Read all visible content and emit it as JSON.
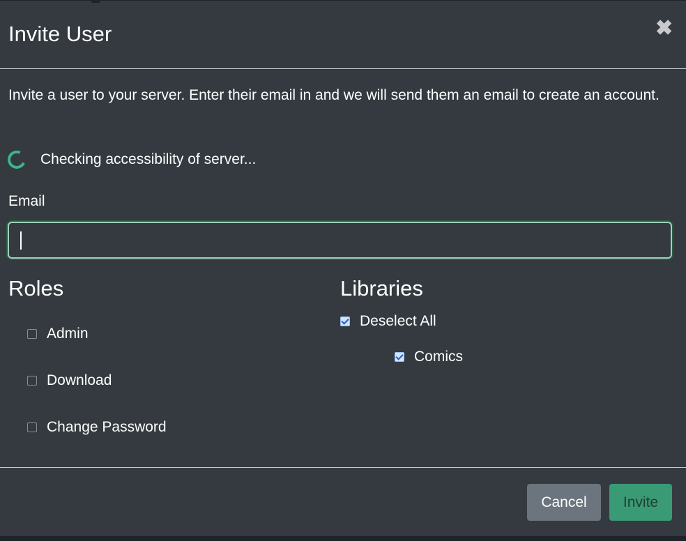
{
  "dialog": {
    "title": "Invite User",
    "close_glyph": "✖",
    "close_icon": "close-icon"
  },
  "body": {
    "intro": "Invite a user to your server. Enter their email in and we will send them an email to create an account.",
    "status": "Checking accessibility of server...",
    "status_icon": "spinner-icon"
  },
  "email": {
    "label": "Email",
    "value": "",
    "placeholder": ""
  },
  "roles": {
    "heading": "Roles",
    "items": [
      {
        "label": "Admin",
        "checked": false
      },
      {
        "label": "Download",
        "checked": false
      },
      {
        "label": "Change Password",
        "checked": false
      }
    ]
  },
  "libraries": {
    "heading": "Libraries",
    "toggle_all": {
      "label": "Deselect All",
      "checked": true
    },
    "items": [
      {
        "label": "Comics",
        "checked": true
      }
    ]
  },
  "footer": {
    "cancel_label": "Cancel",
    "invite_label": "Invite"
  },
  "colors": {
    "background": "#343a40",
    "accent": "#3a9a76",
    "spinner": "#3cb48a",
    "secondary_button": "#6c757d"
  }
}
